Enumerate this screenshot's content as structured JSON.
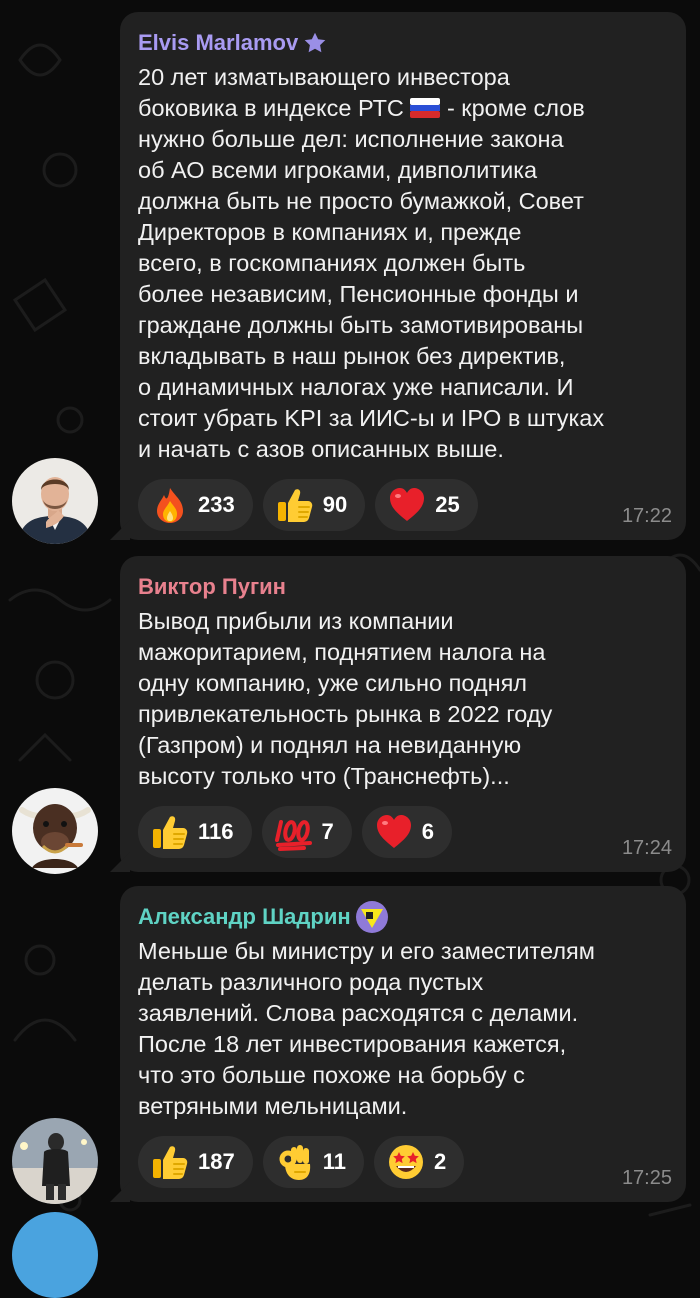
{
  "messages": [
    {
      "author": "Elvis Marlamov",
      "author_color": "#a99bf2",
      "author_badge": "star-icon",
      "text_parts": [
        "20 лет изматывающего инвестора\nбоковика в индексе РТС ",
        " -  кроме слов\nнужно больше дел: исполнение закона\nоб АО всеми игроками, дивполитика\nдолжна быть не просто бумажкой, Совет\nДиректоров в компаниях и, прежде\nвсего, в госкомпаниях должен быть\nболее независим, Пенсионные фонды и\nграждане должны быть замотивированы\nвкладывать в наш рынок без директив,\nо динамичных налогах уже написали. И\nстоит убрать KPI за ИИС-ы и IPO в штуках\nи начать с азов описанных выше."
      ],
      "inline_emoji": "russian-flag-icon",
      "reactions": [
        {
          "emoji": "fire-icon",
          "count": "233"
        },
        {
          "emoji": "thumbs-up-icon",
          "count": "90"
        },
        {
          "emoji": "heart-icon",
          "count": "25"
        }
      ],
      "time": "17:22"
    },
    {
      "author": "Виктор Пугин",
      "author_color": "#e8818e",
      "text": "Вывод прибыли из компании\nмажоритарием, поднятием налога на\nодну компанию, уже сильно поднял\nпривлекательность рынка в 2022 году\n(Газпром) и поднял на невиданную\nвысоту только что (Транснефть)...",
      "reactions": [
        {
          "emoji": "thumbs-up-icon",
          "count": "116"
        },
        {
          "emoji": "hundred-points-icon",
          "count": "7"
        },
        {
          "emoji": "heart-icon",
          "count": "6"
        }
      ],
      "time": "17:24"
    },
    {
      "author": "Александр Шадрин",
      "author_color": "#5fd3c4",
      "author_badge": "yellow-triangle-badge-icon",
      "text": "Меньше бы министру и его заместителям\nделать различного рода пустых\nзаявлений.  Слова расходятся с делами.\nПосле 18 лет инвестирования кажется,\nчто это больше похоже на борьбу с\nветряными мельницами.",
      "reactions": [
        {
          "emoji": "thumbs-up-icon",
          "count": "187"
        },
        {
          "emoji": "ok-hand-icon",
          "count": "11"
        },
        {
          "emoji": "star-struck-icon",
          "count": "2"
        }
      ],
      "time": "17:25"
    }
  ]
}
